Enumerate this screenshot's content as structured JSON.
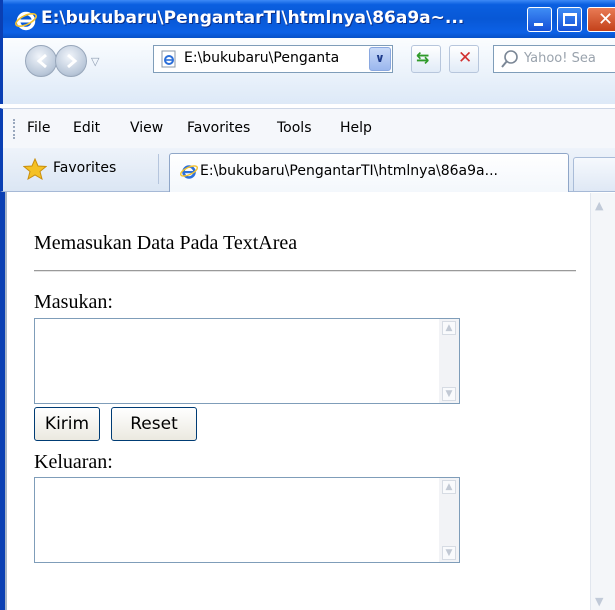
{
  "window": {
    "title": "E:\\bukubaru\\PengantarTI\\htmlnya\\86a9a~...",
    "controls": [
      "minimize-icon",
      "maximize-icon",
      "close-icon"
    ]
  },
  "navbar": {
    "address": "E:\\bukubaru\\Penganta",
    "search_placeholder": "Yahoo! Sea"
  },
  "menu": {
    "items": [
      "File",
      "Edit",
      "View",
      "Favorites",
      "Tools",
      "Help"
    ]
  },
  "tabs": {
    "favorites_label": "Favorites",
    "active_tab_label": "E:\\bukubaru\\PengantarTI\\htmlnya\\86a9a..."
  },
  "page": {
    "heading": "Memasukan Data Pada TextArea",
    "input_label": "Masukan:",
    "input_value": "",
    "submit_label": "Kirim",
    "reset_label": "Reset",
    "output_label": "Keluaran:",
    "output_value": ""
  },
  "colors": {
    "titlebar": "#0858d6",
    "window_border": "#0a3fb3",
    "textarea_border": "#7f9db9",
    "button_border": "#003c74"
  }
}
